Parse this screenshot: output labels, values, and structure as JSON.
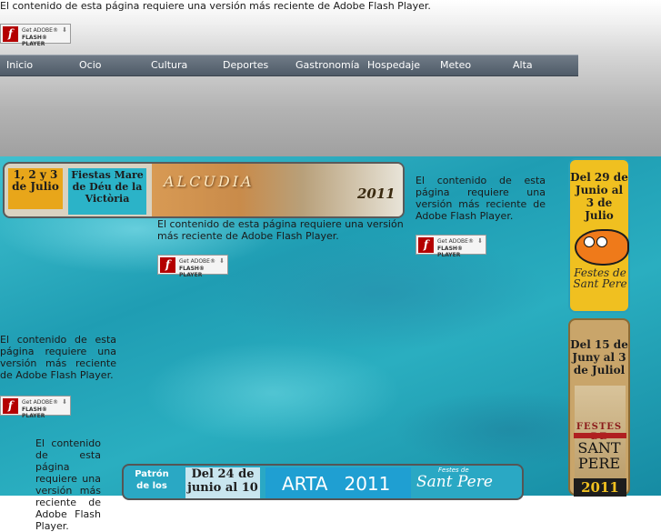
{
  "flash": {
    "message": "El contenido de esta página requiere una versión más reciente de Adobe Flash Player.",
    "button_get": "Get ADOBE®",
    "button_product": "FLASH® PLAYER",
    "logo_letter": "f"
  },
  "nav": {
    "items": [
      "Inicio",
      "Ocio",
      "Cultura",
      "Deportes",
      "Gastronomía",
      "Hospedaje",
      "Meteo",
      "Alta"
    ]
  },
  "banner_alcudia": {
    "dates": "1, 2 y 3 de Julio",
    "fiesta": "Fiestas Mare de Déu de la Victòria",
    "title": "ALCUDIA",
    "year": "2011"
  },
  "banner_sant_pere_1": {
    "dates": "Del 29 de Junio al 3 de Julio",
    "script": "Festes de Sant Pere"
  },
  "banner_sant_pere_2": {
    "dates": "Del 15 de Juny al 3 de Juliol",
    "festes": "FESTES DE",
    "sant": "SANT PERE",
    "year": "2011"
  },
  "banner_arta": {
    "patron": "Patrón de los",
    "dates": "Del 24 de junio al 10",
    "title": "ARTA",
    "year": "2011",
    "festes": "Festes de",
    "sant_pere": "Sant Pere"
  },
  "colors": {
    "nav_bg": "#5d6874",
    "sea": "#2aaec0",
    "flash_red": "#b40000",
    "date_orange": "#e8a61a"
  }
}
